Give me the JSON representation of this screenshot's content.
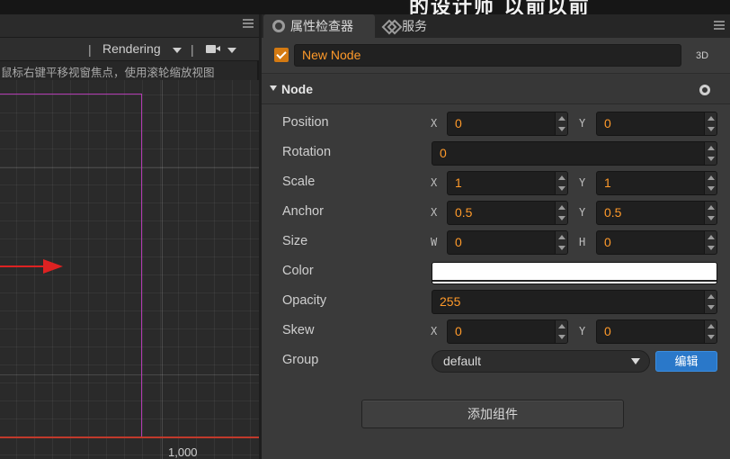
{
  "banner": {
    "text": "的设计师 以前以前"
  },
  "scene": {
    "toolbar": {
      "sep1": "|",
      "render_label": "Rendering",
      "sep2": "|"
    },
    "hint": "鼠标右键平移视窗焦点，使用滚轮缩放视图",
    "coord_label": "1,000"
  },
  "inspector": {
    "tabs": [
      {
        "label": "属性检查器",
        "icon": "gear-icon"
      },
      {
        "label": "服务",
        "icon": "link-icon"
      }
    ],
    "node_name": "New Node",
    "mode_label": "3D",
    "section_title": "Node",
    "props": {
      "position": {
        "label": "Position",
        "x_axis": "X",
        "x": "0",
        "y_axis": "Y",
        "y": "0"
      },
      "rotation": {
        "label": "Rotation",
        "value": "0"
      },
      "scale": {
        "label": "Scale",
        "x_axis": "X",
        "x": "1",
        "y_axis": "Y",
        "y": "1"
      },
      "anchor": {
        "label": "Anchor",
        "x_axis": "X",
        "x": "0.5",
        "y_axis": "Y",
        "y": "0.5"
      },
      "size": {
        "label": "Size",
        "w_axis": "W",
        "w": "0",
        "h_axis": "H",
        "h": "0"
      },
      "color": {
        "label": "Color",
        "value": "#FFFFFF"
      },
      "opacity": {
        "label": "Opacity",
        "value": "255"
      },
      "skew": {
        "label": "Skew",
        "x_axis": "X",
        "x": "0",
        "y_axis": "Y",
        "y": "0"
      },
      "group": {
        "label": "Group",
        "value": "default",
        "edit_label": "编辑"
      }
    },
    "add_component_label": "添加组件"
  },
  "colors": {
    "accent": "#ff9a2a",
    "checkbox": "#d47a12",
    "primary_button": "#2a78c9",
    "canvas_border": "#b03ab0",
    "axis_red": "#d22222"
  }
}
